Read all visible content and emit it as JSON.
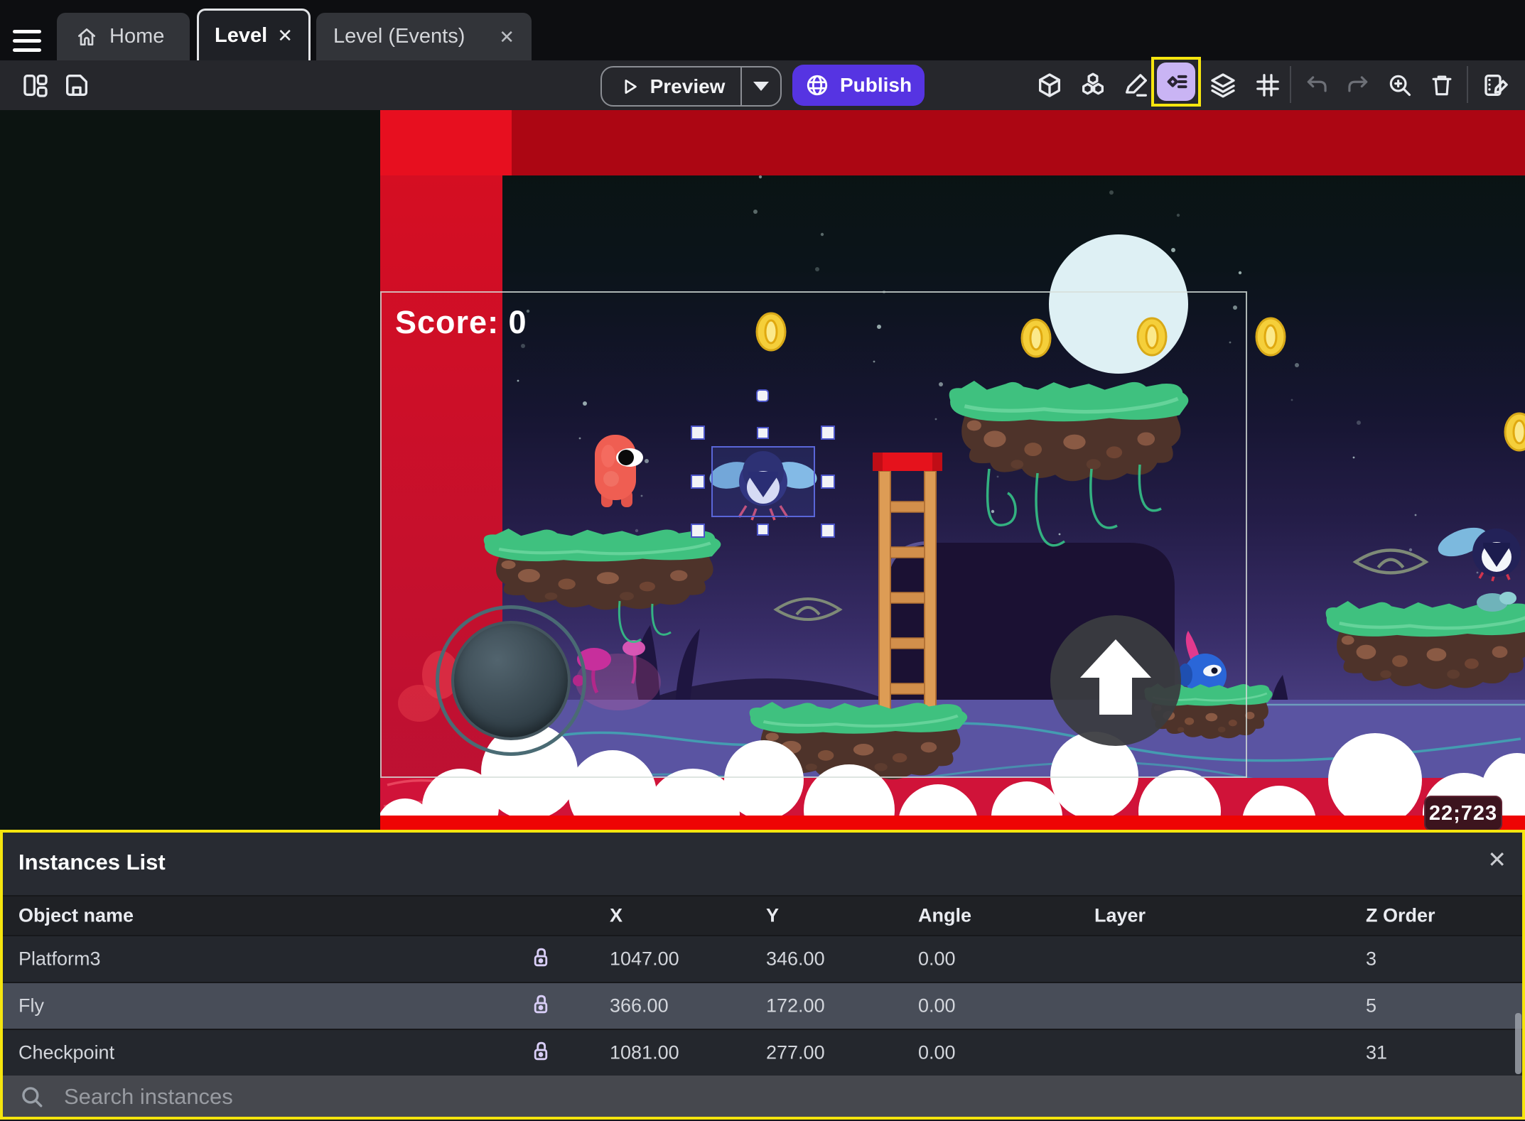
{
  "app": {
    "tab_bar": {
      "tabs": [
        {
          "label": "Home"
        },
        {
          "label": "Level",
          "active": true
        },
        {
          "label": "Level (Events)"
        }
      ]
    },
    "toolbar": {
      "preview_label": "Preview",
      "publish_label": "Publish",
      "icons": [
        "layout-panels",
        "save",
        "3d-box",
        "object-groups",
        "edit-pencil",
        "instances-list",
        "layers",
        "grid",
        "undo",
        "redo",
        "zoom-in",
        "delete",
        "scene-events-edit"
      ]
    }
  },
  "scene": {
    "score_text": "Score: 0",
    "coords_badge": "22;723",
    "selected_object": "Fly"
  },
  "instances_panel": {
    "title": "Instances List",
    "columns": {
      "name": "Object name",
      "x": "X",
      "y": "Y",
      "angle": "Angle",
      "layer": "Layer",
      "z_order": "Z Order"
    },
    "rows": [
      {
        "name": "Platform3",
        "x": "1047.00",
        "y": "346.00",
        "angle": "0.00",
        "layer": "",
        "z_order": "3",
        "selected": false
      },
      {
        "name": "Fly",
        "x": "366.00",
        "y": "172.00",
        "angle": "0.00",
        "layer": "",
        "z_order": "5",
        "selected": true
      },
      {
        "name": "Checkpoint",
        "x": "1081.00",
        "y": "277.00",
        "angle": "0.00",
        "layer": "",
        "z_order": "31",
        "selected": false
      }
    ],
    "search_placeholder": "Search instances"
  },
  "colors": {
    "accent_purple": "#5634e2",
    "highlight_yellow": "#f5e50e",
    "selection_blue": "#5a66d8",
    "wall_red": "#d30f22",
    "ground_red": "#d01339"
  }
}
